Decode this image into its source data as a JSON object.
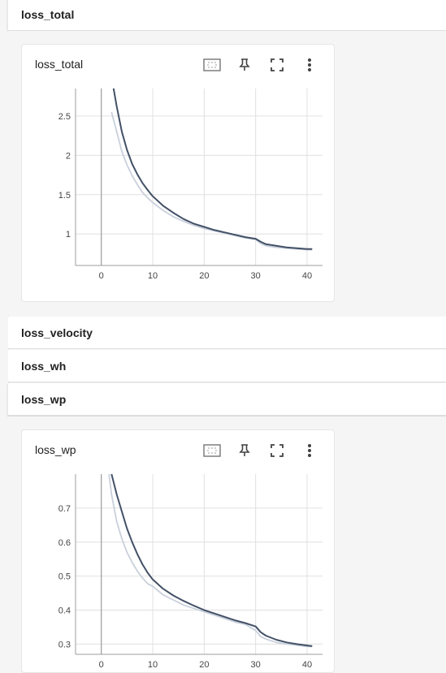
{
  "groups": {
    "loss_total": "loss_total",
    "loss_velocity": "loss_velocity",
    "loss_wh": "loss_wh",
    "loss_wp": "loss_wp"
  },
  "cards": {
    "loss_total": {
      "title": "loss_total"
    },
    "loss_wp": {
      "title": "loss_wp"
    }
  },
  "icons": [
    "fit-domain-icon",
    "pin-icon",
    "fullscreen-icon",
    "more-vert-icon"
  ],
  "colors": {
    "smoothed": "#425066",
    "raw": "#c9d0db",
    "grid": "#e0e0e0"
  },
  "chart_data": [
    {
      "type": "line",
      "title": "loss_total",
      "xlabel": "",
      "ylabel": "",
      "xlim": [
        -5,
        43
      ],
      "ylim": [
        0.6,
        2.85
      ],
      "xticks": [
        0,
        10,
        20,
        30,
        40
      ],
      "yticks": [
        1,
        1.5,
        2,
        2.5
      ],
      "ytick_labels": [
        "1",
        "1.5",
        "2",
        "2.5"
      ],
      "grid": true,
      "series": [
        {
          "role": "raw",
          "x": [
            2,
            3,
            4,
            5,
            6,
            7,
            8,
            9,
            10,
            12,
            14,
            16,
            18,
            20,
            22,
            24,
            26,
            28,
            30,
            31,
            32,
            34,
            36,
            38,
            40,
            41
          ],
          "y": [
            2.55,
            2.3,
            2.05,
            1.88,
            1.74,
            1.63,
            1.53,
            1.46,
            1.4,
            1.3,
            1.22,
            1.16,
            1.11,
            1.07,
            1.04,
            1.01,
            0.98,
            0.95,
            0.93,
            0.88,
            0.85,
            0.83,
            0.82,
            0.81,
            0.8,
            0.8
          ]
        },
        {
          "role": "smoothed",
          "x": [
            2,
            3,
            4,
            5,
            6,
            7,
            8,
            9,
            10,
            12,
            14,
            16,
            18,
            20,
            22,
            24,
            26,
            28,
            30,
            31,
            32,
            34,
            36,
            38,
            40,
            41
          ],
          "y": [
            3.0,
            2.62,
            2.3,
            2.07,
            1.89,
            1.76,
            1.65,
            1.56,
            1.48,
            1.36,
            1.27,
            1.19,
            1.13,
            1.09,
            1.05,
            1.02,
            0.99,
            0.96,
            0.94,
            0.9,
            0.87,
            0.85,
            0.83,
            0.82,
            0.81,
            0.81
          ]
        }
      ]
    },
    {
      "type": "line",
      "title": "loss_wp",
      "xlabel": "",
      "ylabel": "",
      "xlim": [
        -5,
        43
      ],
      "ylim": [
        0.27,
        0.8
      ],
      "xticks": [
        0,
        10,
        20,
        30,
        40
      ],
      "yticks": [
        0.3,
        0.4,
        0.5,
        0.6,
        0.7
      ],
      "ytick_labels": [
        "0.3",
        "0.4",
        "0.5",
        "0.6",
        "0.7"
      ],
      "grid": true,
      "series": [
        {
          "role": "raw",
          "x": [
            1.5,
            2,
            3,
            4,
            5,
            6,
            7,
            8,
            9,
            10,
            12,
            14,
            16,
            18,
            20,
            22,
            24,
            26,
            28,
            30,
            31,
            32,
            34,
            36,
            38,
            40,
            41
          ],
          "y": [
            0.8,
            0.74,
            0.66,
            0.61,
            0.57,
            0.54,
            0.515,
            0.495,
            0.478,
            0.47,
            0.445,
            0.43,
            0.415,
            0.405,
            0.395,
            0.385,
            0.375,
            0.365,
            0.358,
            0.34,
            0.322,
            0.315,
            0.305,
            0.3,
            0.297,
            0.293,
            0.293
          ]
        },
        {
          "role": "smoothed",
          "x": [
            2,
            3,
            4,
            5,
            6,
            7,
            8,
            9,
            10,
            12,
            14,
            16,
            18,
            20,
            22,
            24,
            26,
            28,
            30,
            31,
            32,
            34,
            36,
            38,
            40,
            41
          ],
          "y": [
            0.8,
            0.74,
            0.69,
            0.64,
            0.6,
            0.565,
            0.535,
            0.51,
            0.49,
            0.463,
            0.443,
            0.427,
            0.413,
            0.4,
            0.39,
            0.38,
            0.37,
            0.362,
            0.352,
            0.335,
            0.325,
            0.313,
            0.305,
            0.3,
            0.296,
            0.294
          ]
        }
      ]
    }
  ]
}
